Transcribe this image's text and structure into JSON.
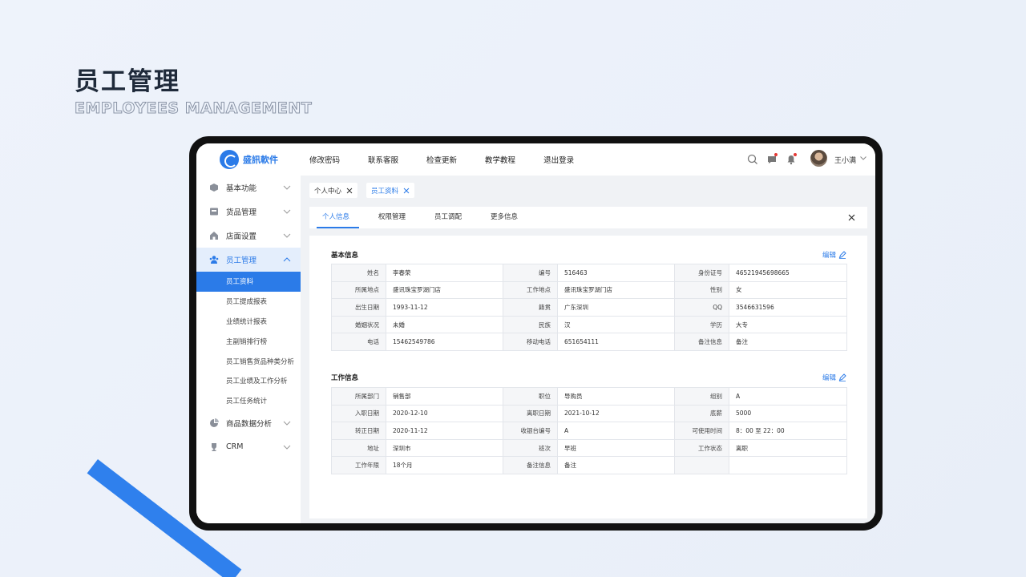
{
  "hero": {
    "title": "员工管理",
    "subtitle": "EMPLOYEES MANAGEMENT"
  },
  "brand": {
    "name": "盛訊軟件",
    "color": "#2b7be8"
  },
  "topnav": [
    "修改密码",
    "联系客服",
    "检查更新",
    "教学教程",
    "退出登录"
  ],
  "user": {
    "name": "王小满"
  },
  "sidebar": {
    "items": [
      {
        "label": "基本功能",
        "icon": "cube-icon"
      },
      {
        "label": "货品管理",
        "icon": "basket-icon"
      },
      {
        "label": "店面设置",
        "icon": "home-icon"
      },
      {
        "label": "员工管理",
        "icon": "users-icon",
        "open": true
      },
      {
        "label": "商品数据分析",
        "icon": "pie-chart-icon"
      },
      {
        "label": "CRM",
        "icon": "trophy-icon"
      }
    ],
    "subitems": [
      "员工资料",
      "员工提成报表",
      "业绩统计报表",
      "主副销排行榜",
      "员工销售货品种类分析",
      "员工业绩及工作分析",
      "员工任务统计"
    ]
  },
  "chips": [
    "个人中心",
    "员工资料"
  ],
  "tabs": [
    "个人信息",
    "权限管理",
    "员工调配",
    "更多信息"
  ],
  "basic": {
    "title": "基本信息",
    "edit": "编辑",
    "rows": [
      [
        "姓名",
        "李春荣",
        "编号",
        "516463",
        "身份证号",
        "46521945698665"
      ],
      [
        "所属地点",
        "盛讯珠宝罗湖门店",
        "工作地点",
        "盛讯珠宝罗湖门店",
        "性别",
        "女"
      ],
      [
        "出生日期",
        "1993-11-12",
        "籍贯",
        "广东深圳",
        "QQ",
        "3546631596"
      ],
      [
        "婚姻状况",
        "未婚",
        "民族",
        "汉",
        "学历",
        "大专"
      ],
      [
        "电话",
        "15462549786",
        "移动电话",
        "651654111",
        "备注信息",
        "备注"
      ]
    ]
  },
  "work": {
    "title": "工作信息",
    "edit": "编辑",
    "rows": [
      [
        "所属部门",
        "销售部",
        "职位",
        "导购员",
        "组别",
        "A"
      ],
      [
        "入职日期",
        "2020-12-10",
        "离职日期",
        "2021-10-12",
        "底薪",
        "5000"
      ],
      [
        "转正日期",
        "2020-11-12",
        "收银台编号",
        "A",
        "可使用时间",
        "8：00 至 22：00"
      ],
      [
        "地址",
        "深圳市",
        "班次",
        "早班",
        "工作状态",
        "离职"
      ],
      [
        "工作年限",
        "18个月",
        "备注信息",
        "备注",
        "",
        ""
      ]
    ]
  }
}
